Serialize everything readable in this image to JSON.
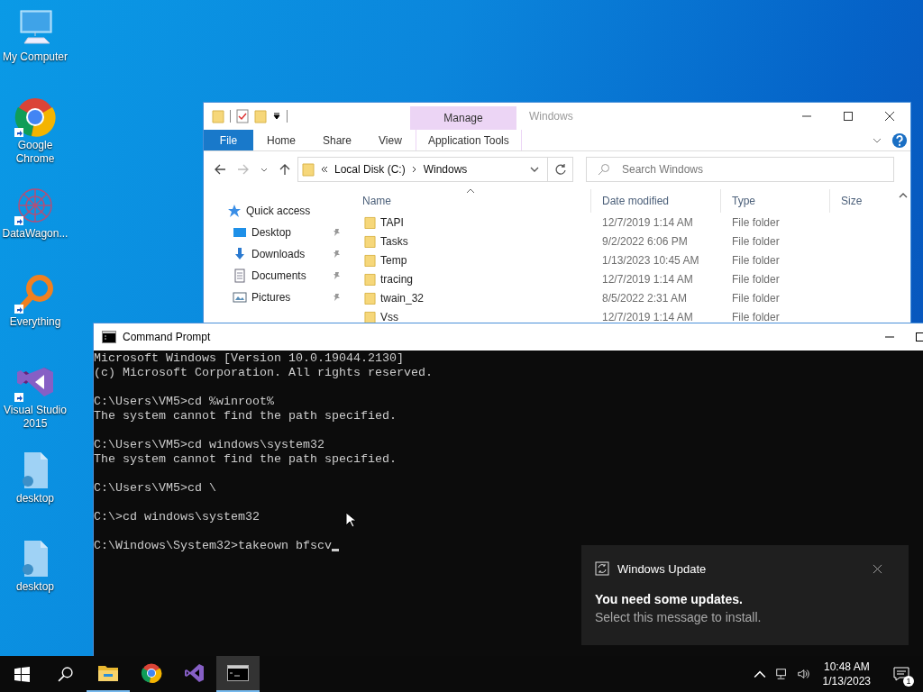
{
  "desktop_icons": [
    {
      "label": "My Computer",
      "kind": "computer",
      "shortcut": false
    },
    {
      "label": "Google Chrome",
      "kind": "chrome",
      "shortcut": true
    },
    {
      "label": "DataWagon...",
      "kind": "datawagon",
      "shortcut": true
    },
    {
      "label": "Everything",
      "kind": "everything",
      "shortcut": true
    },
    {
      "label": "Visual Studio 2015",
      "kind": "vs",
      "shortcut": true
    },
    {
      "label": "desktop",
      "kind": "file",
      "shortcut": false
    },
    {
      "label": "desktop",
      "kind": "file",
      "shortcut": false
    }
  ],
  "explorer": {
    "title": "Windows",
    "contextual_group": "Manage",
    "file_tab": "File",
    "tabs": [
      {
        "label": "Home",
        "kind": "plain"
      },
      {
        "label": "Share",
        "kind": "plain"
      },
      {
        "label": "View",
        "kind": "plain"
      },
      {
        "label": "Application Tools",
        "kind": "contextual"
      }
    ],
    "path": [
      "Local Disk (C:)",
      "Windows"
    ],
    "search": {
      "placeholder": "Search Windows"
    },
    "quick_access": "Quick access",
    "nav_items": [
      {
        "label": "Desktop",
        "kind": "desktop",
        "pinned": true
      },
      {
        "label": "Downloads",
        "kind": "downloads",
        "pinned": true
      },
      {
        "label": "Documents",
        "kind": "documents",
        "pinned": true
      },
      {
        "label": "Pictures",
        "kind": "pictures",
        "pinned": true
      }
    ],
    "columns": [
      "Name",
      "Date modified",
      "Type",
      "Size"
    ],
    "rows": [
      {
        "name": "TAPI",
        "date": "12/7/2019 1:14 AM",
        "type": "File folder"
      },
      {
        "name": "Tasks",
        "date": "9/2/2022 6:06 PM",
        "type": "File folder"
      },
      {
        "name": "Temp",
        "date": "1/13/2023 10:45 AM",
        "type": "File folder"
      },
      {
        "name": "tracing",
        "date": "12/7/2019 1:14 AM",
        "type": "File folder"
      },
      {
        "name": "twain_32",
        "date": "8/5/2022 2:31 AM",
        "type": "File folder"
      },
      {
        "name": "Vss",
        "date": "12/7/2019 1:14 AM",
        "type": "File folder"
      }
    ]
  },
  "console": {
    "title": "Command Prompt",
    "blocks": [
      [
        "Microsoft Windows [Version 10.0.19044.2130]",
        "(c) Microsoft Corporation. All rights reserved."
      ],
      [
        "C:\\Users\\VM5>cd %winroot%",
        "The system cannot find the path specified."
      ],
      [
        "C:\\Users\\VM5>cd windows\\system32",
        "The system cannot find the path specified."
      ],
      [
        "C:\\Users\\VM5>cd \\"
      ],
      [
        "C:\\>cd windows\\system32"
      ],
      [
        "C:\\Windows\\System32>takeown bfscv"
      ]
    ]
  },
  "notification": {
    "app": "Windows Update",
    "title": "You need some updates.",
    "body": "Select this message to install."
  },
  "taskbar": {
    "apps": [
      {
        "kind": "explorer",
        "running": true,
        "selected": false
      },
      {
        "kind": "chrome",
        "running": false,
        "selected": false
      },
      {
        "kind": "vs",
        "running": false,
        "selected": false
      },
      {
        "kind": "console",
        "running": true,
        "selected": true
      }
    ],
    "time": "10:48 AM",
    "date": "1/13/2023",
    "notification_count": "1"
  }
}
